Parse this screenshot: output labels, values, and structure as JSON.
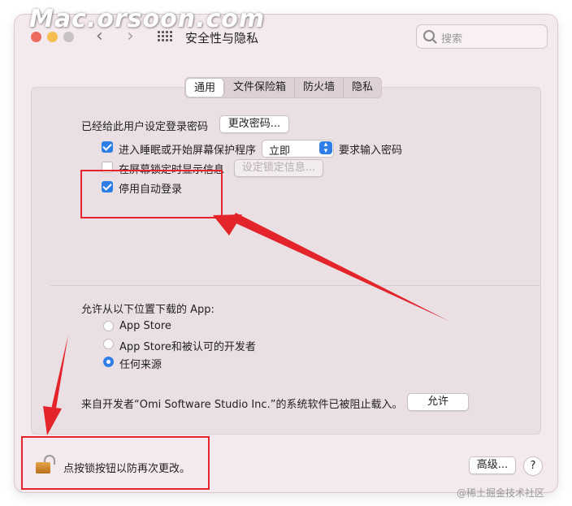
{
  "watermark": "Mac.orsoon.com",
  "window": {
    "title": "安全性与隐私"
  },
  "search": {
    "placeholder": "搜索"
  },
  "tabs": [
    {
      "label": "通用",
      "active": true
    },
    {
      "label": "文件保险箱",
      "active": false
    },
    {
      "label": "防火墙",
      "active": false
    },
    {
      "label": "隐私",
      "active": false
    }
  ],
  "general": {
    "password_set_label": "已经给此用户设定登录密码",
    "change_password_button": "更改密码...",
    "require_password": {
      "checked": true,
      "label": "进入睡眠或开始屏幕保护程序",
      "suffix": "要求输入密码"
    },
    "require_password_delay": "立即",
    "lock_message": {
      "checked": false,
      "label": "在屏幕锁定时显示信息",
      "button": "设定锁定信息..."
    },
    "disable_auto_login": {
      "checked": true,
      "label": "停用自动登录"
    }
  },
  "downloads": {
    "heading": "允许从以下位置下载的 App:",
    "options": [
      {
        "label": "App Store",
        "selected": false
      },
      {
        "label": "App Store和被认可的开发者",
        "selected": false
      },
      {
        "label": "任何来源",
        "selected": true
      }
    ]
  },
  "blocked": {
    "message": "来自开发者“Omi Software Studio Inc.”的系统软件已被阻止载入。",
    "allow_button": "允许"
  },
  "footer": {
    "lock_text": "点按锁按钮以防再次更改。",
    "advanced_button": "高级...",
    "help_button": "?"
  },
  "credit": "@稀土掘金技术社区",
  "colors": {
    "accent": "#2f7ee8",
    "annotation": "#e3242b",
    "window_bg": "#f4e9ec"
  }
}
